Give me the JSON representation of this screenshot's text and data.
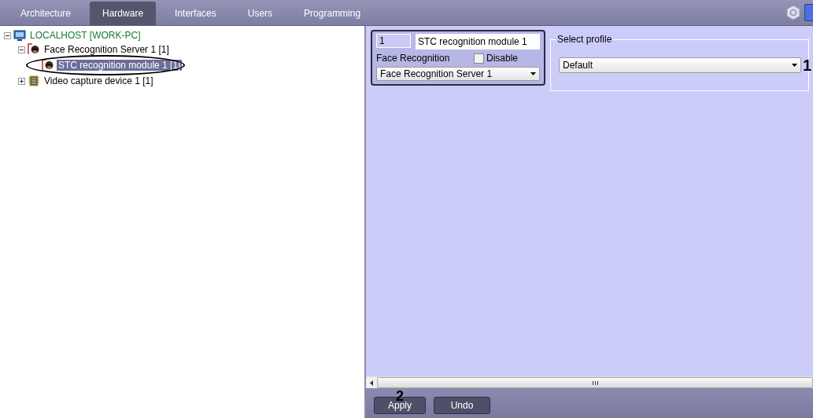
{
  "tabs": [
    {
      "label": "Architecture",
      "selected": false
    },
    {
      "label": "Hardware",
      "selected": true
    },
    {
      "label": "Interfaces",
      "selected": false
    },
    {
      "label": "Users",
      "selected": false
    },
    {
      "label": "Programming",
      "selected": false
    }
  ],
  "tree": [
    {
      "label": "LOCALHOST [WORK-PC]",
      "kind": "computer",
      "expanded": true,
      "selected": false,
      "children": [
        {
          "label": "Face Recognition Server 1 [1]",
          "kind": "face",
          "expanded": true,
          "selected": false,
          "children": [
            {
              "label": "STC recognition module 1 [1]",
              "kind": "face",
              "selected": true,
              "circled": true
            }
          ]
        },
        {
          "label": "Video capture device 1 [1]",
          "kind": "chip",
          "expanded": false,
          "selected": false
        }
      ]
    }
  ],
  "object_panel": {
    "id": "1",
    "name": "STC recognition module 1",
    "type_label": "Face Recognition",
    "disable": {
      "label": "Disable",
      "checked": false
    },
    "parent_select": "Face Recognition Server 1"
  },
  "profile_group": {
    "title": "Select profile",
    "select": "Default",
    "callout": "1"
  },
  "footer": {
    "callout": "2",
    "buttons": [
      "Apply",
      "Undo"
    ]
  }
}
